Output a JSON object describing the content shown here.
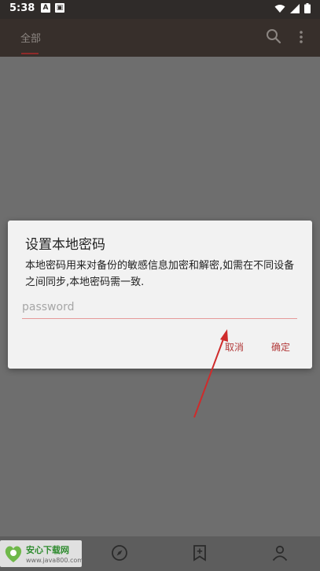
{
  "status_bar": {
    "time": "5:38",
    "left_icons": [
      "notification-a-icon",
      "notification-image-icon"
    ],
    "right_icons": [
      "wifi-icon",
      "signal-icon",
      "battery-icon"
    ]
  },
  "app_bar": {
    "tab_all": "全部",
    "icons": [
      "search-icon",
      "more-vert-icon"
    ]
  },
  "dialog": {
    "title": "设置本地密码",
    "message": "本地密码用来对备份的敏感信息加密和解密,如需在不同设备之间同步,本地密码需一致.",
    "input_value": "",
    "input_placeholder": "password",
    "cancel_label": "取消",
    "ok_label": "确定"
  },
  "bottom_nav": {
    "items": [
      "home-icon",
      "compass-icon",
      "bookmark-add-icon",
      "person-icon"
    ]
  },
  "watermark": {
    "logo_text": "安心下载网",
    "url": "www.java800.com"
  },
  "colors": {
    "accent": "#b23a3a",
    "app_bar": "#372f2b",
    "overlay": "#6e6e6e",
    "dialog_bg": "#f2f2f2"
  }
}
